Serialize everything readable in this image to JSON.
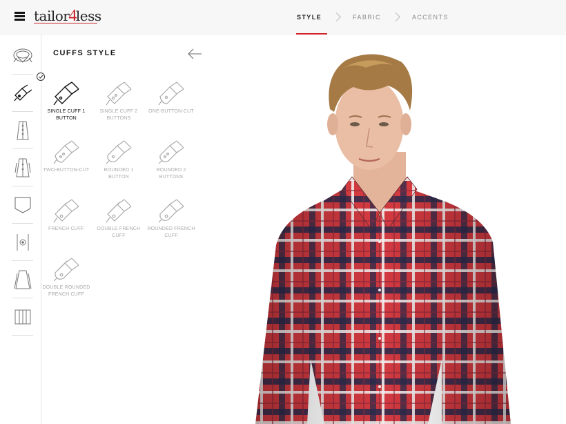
{
  "header": {
    "logo_prefix": "tailor",
    "logo_number": "4",
    "logo_suffix": "less",
    "steps": [
      "STYLE",
      "FABRIC",
      "ACCENTS"
    ],
    "active_step": "STYLE"
  },
  "rail": {
    "items": [
      {
        "name": "collar-icon"
      },
      {
        "name": "cuff-icon"
      },
      {
        "name": "placket-icon"
      },
      {
        "name": "front-icon"
      },
      {
        "name": "pocket-icon"
      },
      {
        "name": "button-icon"
      },
      {
        "name": "sleeve-icon"
      },
      {
        "name": "back-pleat-icon"
      }
    ]
  },
  "panel": {
    "title": "CUFFS STYLE",
    "options": [
      {
        "line1": "SINGLE CUFF 1",
        "line2": "BUTTON",
        "selected": true
      },
      {
        "line1": "SINGLE CUFF 2",
        "line2": "BUTTONS",
        "selected": false
      },
      {
        "line1": "ONE-BUTTON-CUT",
        "line2": "",
        "selected": false
      },
      {
        "line1": "TWO-BUTTON-CUT",
        "line2": "",
        "selected": false
      },
      {
        "line1": "ROUNDED 1",
        "line2": "BUTTON",
        "selected": false
      },
      {
        "line1": "ROUNDED 2",
        "line2": "BUTTONS",
        "selected": false
      },
      {
        "line1": "FRENCH CUFF",
        "line2": "",
        "selected": false
      },
      {
        "line1": "DOUBLE FRENCH",
        "line2": "CUFF",
        "selected": false
      },
      {
        "line1": "ROUNDED FRENCH",
        "line2": "CUFF",
        "selected": false
      },
      {
        "line1": "DOUBLE ROUNDED",
        "line2": "FRENCH CUFF",
        "selected": false
      }
    ]
  },
  "colors": {
    "accent": "#d2232a",
    "shirt_red": "#d23a40",
    "shirt_navy": "#2b2a4c",
    "shirt_white": "#f2ecec"
  }
}
